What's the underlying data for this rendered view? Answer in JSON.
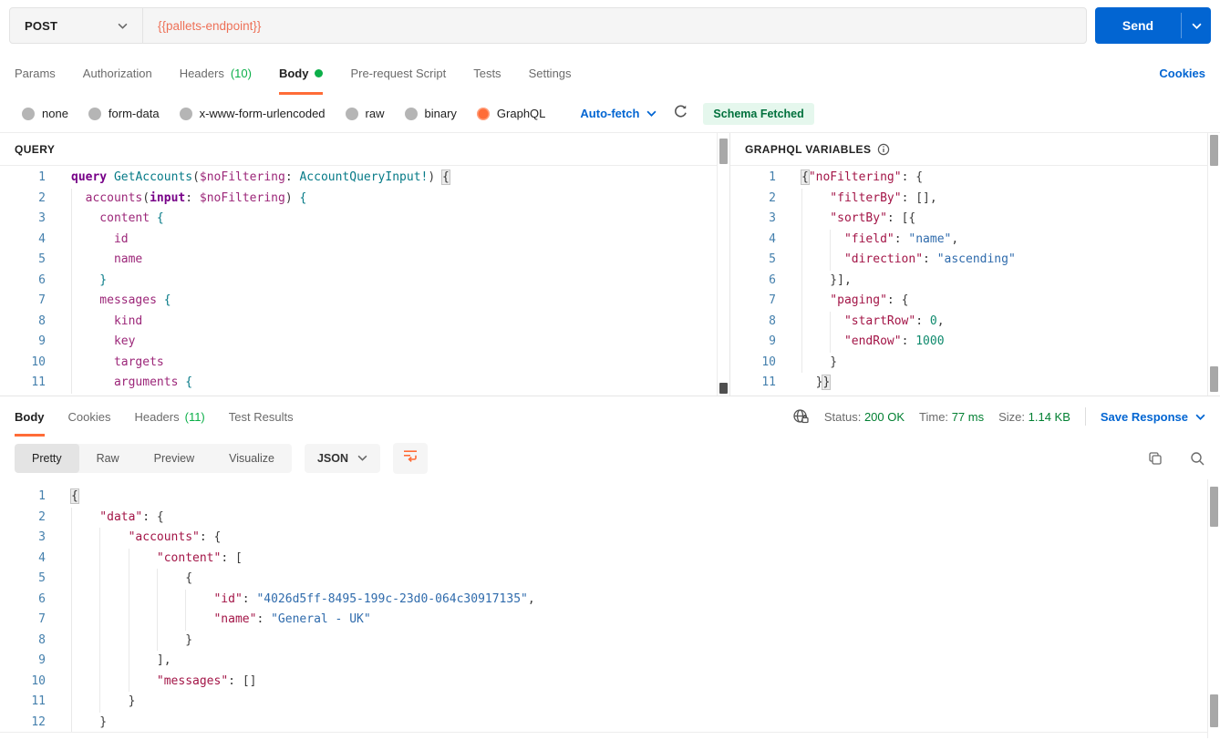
{
  "colors": {
    "accent_orange": "#ff6c37",
    "primary_blue": "#0265d2",
    "count_green": "#0caf49",
    "status_green": "#007f31",
    "url_variable": "#ee7158",
    "badge_bg": "#e5f7ed",
    "badge_text": "#00703c"
  },
  "request_bar": {
    "method": "POST",
    "url": "{{pallets-endpoint}}",
    "send": "Send"
  },
  "request_tabs": {
    "items": [
      {
        "label": "Params"
      },
      {
        "label": "Authorization"
      },
      {
        "label": "Headers",
        "count": "(10)"
      },
      {
        "label": "Body",
        "active": true,
        "dot": true
      },
      {
        "label": "Pre-request Script"
      },
      {
        "label": "Tests"
      },
      {
        "label": "Settings"
      }
    ],
    "cookies": "Cookies"
  },
  "body_type": {
    "options": [
      {
        "label": "none"
      },
      {
        "label": "form-data"
      },
      {
        "label": "x-www-form-urlencoded"
      },
      {
        "label": "raw"
      },
      {
        "label": "binary"
      },
      {
        "label": "GraphQL",
        "selected": true
      }
    ],
    "autofetch": "Auto-fetch",
    "schema_status": "Schema Fetched"
  },
  "editors": {
    "query": {
      "title": "QUERY",
      "lines": [
        {
          "n": 1,
          "t": [
            [
              "kw",
              "query"
            ],
            [
              "pl",
              " "
            ],
            [
              "ty",
              "GetAccounts"
            ],
            [
              "pl",
              "("
            ],
            [
              "fld",
              "$noFiltering"
            ],
            [
              "pl",
              ": "
            ],
            [
              "ty",
              "AccountQueryInput!"
            ],
            [
              "pl",
              ") "
            ],
            [
              "mb",
              "{"
            ]
          ]
        },
        {
          "n": 2,
          "t": [
            [
              "g",
              2
            ],
            [
              "fld",
              "accounts"
            ],
            [
              "pl",
              "("
            ],
            [
              "kw",
              "input"
            ],
            [
              "pl",
              ": "
            ],
            [
              "fld",
              "$noFiltering"
            ],
            [
              "pl",
              ") "
            ],
            [
              "br",
              "{"
            ]
          ]
        },
        {
          "n": 3,
          "t": [
            [
              "g",
              2
            ],
            [
              "pl",
              "  "
            ],
            [
              "fld",
              "content"
            ],
            [
              "pl",
              " "
            ],
            [
              "br",
              "{"
            ]
          ]
        },
        {
          "n": 4,
          "t": [
            [
              "g",
              2
            ],
            [
              "pl",
              "    "
            ],
            [
              "fld",
              "id"
            ]
          ]
        },
        {
          "n": 5,
          "t": [
            [
              "g",
              2
            ],
            [
              "pl",
              "    "
            ],
            [
              "fld",
              "name"
            ]
          ]
        },
        {
          "n": 6,
          "t": [
            [
              "g",
              2
            ],
            [
              "pl",
              "  "
            ],
            [
              "br",
              "}"
            ]
          ]
        },
        {
          "n": 7,
          "t": [
            [
              "g",
              2
            ],
            [
              "pl",
              "  "
            ],
            [
              "fld",
              "messages"
            ],
            [
              "pl",
              " "
            ],
            [
              "br",
              "{"
            ]
          ]
        },
        {
          "n": 8,
          "t": [
            [
              "g",
              2
            ],
            [
              "pl",
              "    "
            ],
            [
              "fld",
              "kind"
            ]
          ]
        },
        {
          "n": 9,
          "t": [
            [
              "g",
              2
            ],
            [
              "pl",
              "    "
            ],
            [
              "fld",
              "key"
            ]
          ]
        },
        {
          "n": 10,
          "t": [
            [
              "g",
              2
            ],
            [
              "pl",
              "    "
            ],
            [
              "fld",
              "targets"
            ]
          ]
        },
        {
          "n": 11,
          "t": [
            [
              "g",
              2
            ],
            [
              "pl",
              "    "
            ],
            [
              "fld",
              "arguments"
            ],
            [
              "pl",
              " "
            ],
            [
              "br",
              "{"
            ]
          ]
        }
      ]
    },
    "variables": {
      "title": "GRAPHQL VARIABLES",
      "lines": [
        {
          "n": 1,
          "t": [
            [
              "mb",
              "{"
            ],
            [
              "key",
              "\"noFiltering\""
            ],
            [
              "pl",
              ": {"
            ]
          ]
        },
        {
          "n": 2,
          "t": [
            [
              "g",
              4
            ],
            [
              "key",
              "\"filterBy\""
            ],
            [
              "pl",
              ": [],"
            ]
          ]
        },
        {
          "n": 3,
          "t": [
            [
              "g",
              4
            ],
            [
              "key",
              "\"sortBy\""
            ],
            [
              "pl",
              ": [{"
            ]
          ]
        },
        {
          "n": 4,
          "t": [
            [
              "g",
              4
            ],
            [
              "g",
              2
            ],
            [
              "key",
              "\"field\""
            ],
            [
              "pl",
              ": "
            ],
            [
              "str",
              "\"name\""
            ],
            [
              "pl",
              ","
            ]
          ]
        },
        {
          "n": 5,
          "t": [
            [
              "g",
              4
            ],
            [
              "g",
              2
            ],
            [
              "key",
              "\"direction\""
            ],
            [
              "pl",
              ": "
            ],
            [
              "str",
              "\"ascending\""
            ]
          ]
        },
        {
          "n": 6,
          "t": [
            [
              "g",
              4
            ],
            [
              "pl",
              "}],"
            ]
          ]
        },
        {
          "n": 7,
          "t": [
            [
              "g",
              4
            ],
            [
              "key",
              "\"paging\""
            ],
            [
              "pl",
              ": {"
            ]
          ]
        },
        {
          "n": 8,
          "t": [
            [
              "g",
              4
            ],
            [
              "g",
              2
            ],
            [
              "key",
              "\"startRow\""
            ],
            [
              "pl",
              ": "
            ],
            [
              "num",
              "0"
            ],
            [
              "pl",
              ","
            ]
          ]
        },
        {
          "n": 9,
          "t": [
            [
              "g",
              4
            ],
            [
              "g",
              2
            ],
            [
              "key",
              "\"endRow\""
            ],
            [
              "pl",
              ": "
            ],
            [
              "num",
              "1000"
            ]
          ]
        },
        {
          "n": 10,
          "t": [
            [
              "g",
              4
            ],
            [
              "pl",
              "}"
            ]
          ]
        },
        {
          "n": 11,
          "t": [
            [
              "pl",
              "  }"
            ],
            [
              "mb",
              "}"
            ]
          ]
        }
      ]
    },
    "response_body": {
      "lines": [
        {
          "n": 1,
          "t": [
            [
              "mb",
              "{"
            ]
          ]
        },
        {
          "n": 2,
          "t": [
            [
              "g",
              4
            ],
            [
              "key",
              "\"data\""
            ],
            [
              "pl",
              ": {"
            ]
          ]
        },
        {
          "n": 3,
          "t": [
            [
              "g",
              4
            ],
            [
              "g",
              4
            ],
            [
              "key",
              "\"accounts\""
            ],
            [
              "pl",
              ": {"
            ]
          ]
        },
        {
          "n": 4,
          "t": [
            [
              "g",
              4
            ],
            [
              "g",
              4
            ],
            [
              "g",
              4
            ],
            [
              "key",
              "\"content\""
            ],
            [
              "pl",
              ": ["
            ]
          ]
        },
        {
          "n": 5,
          "t": [
            [
              "g",
              4
            ],
            [
              "g",
              4
            ],
            [
              "g",
              4
            ],
            [
              "g",
              4
            ],
            [
              "pl",
              "{"
            ]
          ]
        },
        {
          "n": 6,
          "t": [
            [
              "g",
              4
            ],
            [
              "g",
              4
            ],
            [
              "g",
              4
            ],
            [
              "g",
              4
            ],
            [
              "g",
              4
            ],
            [
              "key",
              "\"id\""
            ],
            [
              "pl",
              ": "
            ],
            [
              "str",
              "\"4026d5ff-8495-199c-23d0-064c30917135\""
            ],
            [
              "pl",
              ","
            ]
          ]
        },
        {
          "n": 7,
          "t": [
            [
              "g",
              4
            ],
            [
              "g",
              4
            ],
            [
              "g",
              4
            ],
            [
              "g",
              4
            ],
            [
              "g",
              4
            ],
            [
              "key",
              "\"name\""
            ],
            [
              "pl",
              ": "
            ],
            [
              "str",
              "\"General - UK\""
            ]
          ]
        },
        {
          "n": 8,
          "t": [
            [
              "g",
              4
            ],
            [
              "g",
              4
            ],
            [
              "g",
              4
            ],
            [
              "g",
              4
            ],
            [
              "pl",
              "}"
            ]
          ]
        },
        {
          "n": 9,
          "t": [
            [
              "g",
              4
            ],
            [
              "g",
              4
            ],
            [
              "g",
              4
            ],
            [
              "pl",
              "],"
            ]
          ]
        },
        {
          "n": 10,
          "t": [
            [
              "g",
              4
            ],
            [
              "g",
              4
            ],
            [
              "g",
              4
            ],
            [
              "key",
              "\"messages\""
            ],
            [
              "pl",
              ": []"
            ]
          ]
        },
        {
          "n": 11,
          "t": [
            [
              "g",
              4
            ],
            [
              "g",
              4
            ],
            [
              "pl",
              "}"
            ]
          ]
        },
        {
          "n": 12,
          "t": [
            [
              "g",
              4
            ],
            [
              "pl",
              "}"
            ]
          ]
        }
      ]
    }
  },
  "response": {
    "tabs": [
      {
        "label": "Body",
        "active": true
      },
      {
        "label": "Cookies"
      },
      {
        "label": "Headers",
        "count": "(11)"
      },
      {
        "label": "Test Results"
      }
    ],
    "meta": {
      "status_label": "Status:",
      "status_value": "200 OK",
      "time_label": "Time:",
      "time_value": "77 ms",
      "size_label": "Size:",
      "size_value": "1.14 KB",
      "save": "Save Response"
    },
    "view_tabs": [
      {
        "label": "Pretty",
        "active": true
      },
      {
        "label": "Raw"
      },
      {
        "label": "Preview"
      },
      {
        "label": "Visualize"
      }
    ],
    "format": "JSON"
  }
}
